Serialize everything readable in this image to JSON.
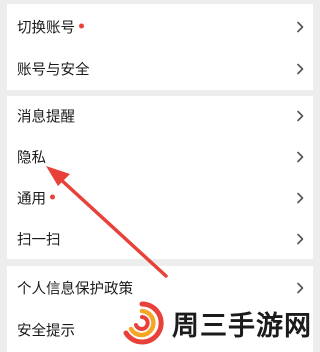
{
  "settings": {
    "groups": [
      {
        "items": [
          {
            "label": "切换账号",
            "badge": true
          },
          {
            "label": "账号与安全",
            "badge": false
          }
        ]
      },
      {
        "items": [
          {
            "label": "消息提醒",
            "badge": false
          },
          {
            "label": "隐私",
            "badge": false
          },
          {
            "label": "通用",
            "badge": true
          },
          {
            "label": "扫一扫",
            "badge": false
          }
        ]
      },
      {
        "items": [
          {
            "label": "个人信息保护政策",
            "badge": false
          },
          {
            "label": "安全提示",
            "badge": false
          }
        ]
      }
    ]
  },
  "annotation": {
    "arrow_color": "#e8413a",
    "points_to": "隐私"
  },
  "watermark": {
    "text": "周三手游网",
    "logo_colors": [
      "#e8413a",
      "#f6a623"
    ]
  },
  "colors": {
    "badge": "#e8413a",
    "chevron": "#555555",
    "background": "#ededed"
  }
}
